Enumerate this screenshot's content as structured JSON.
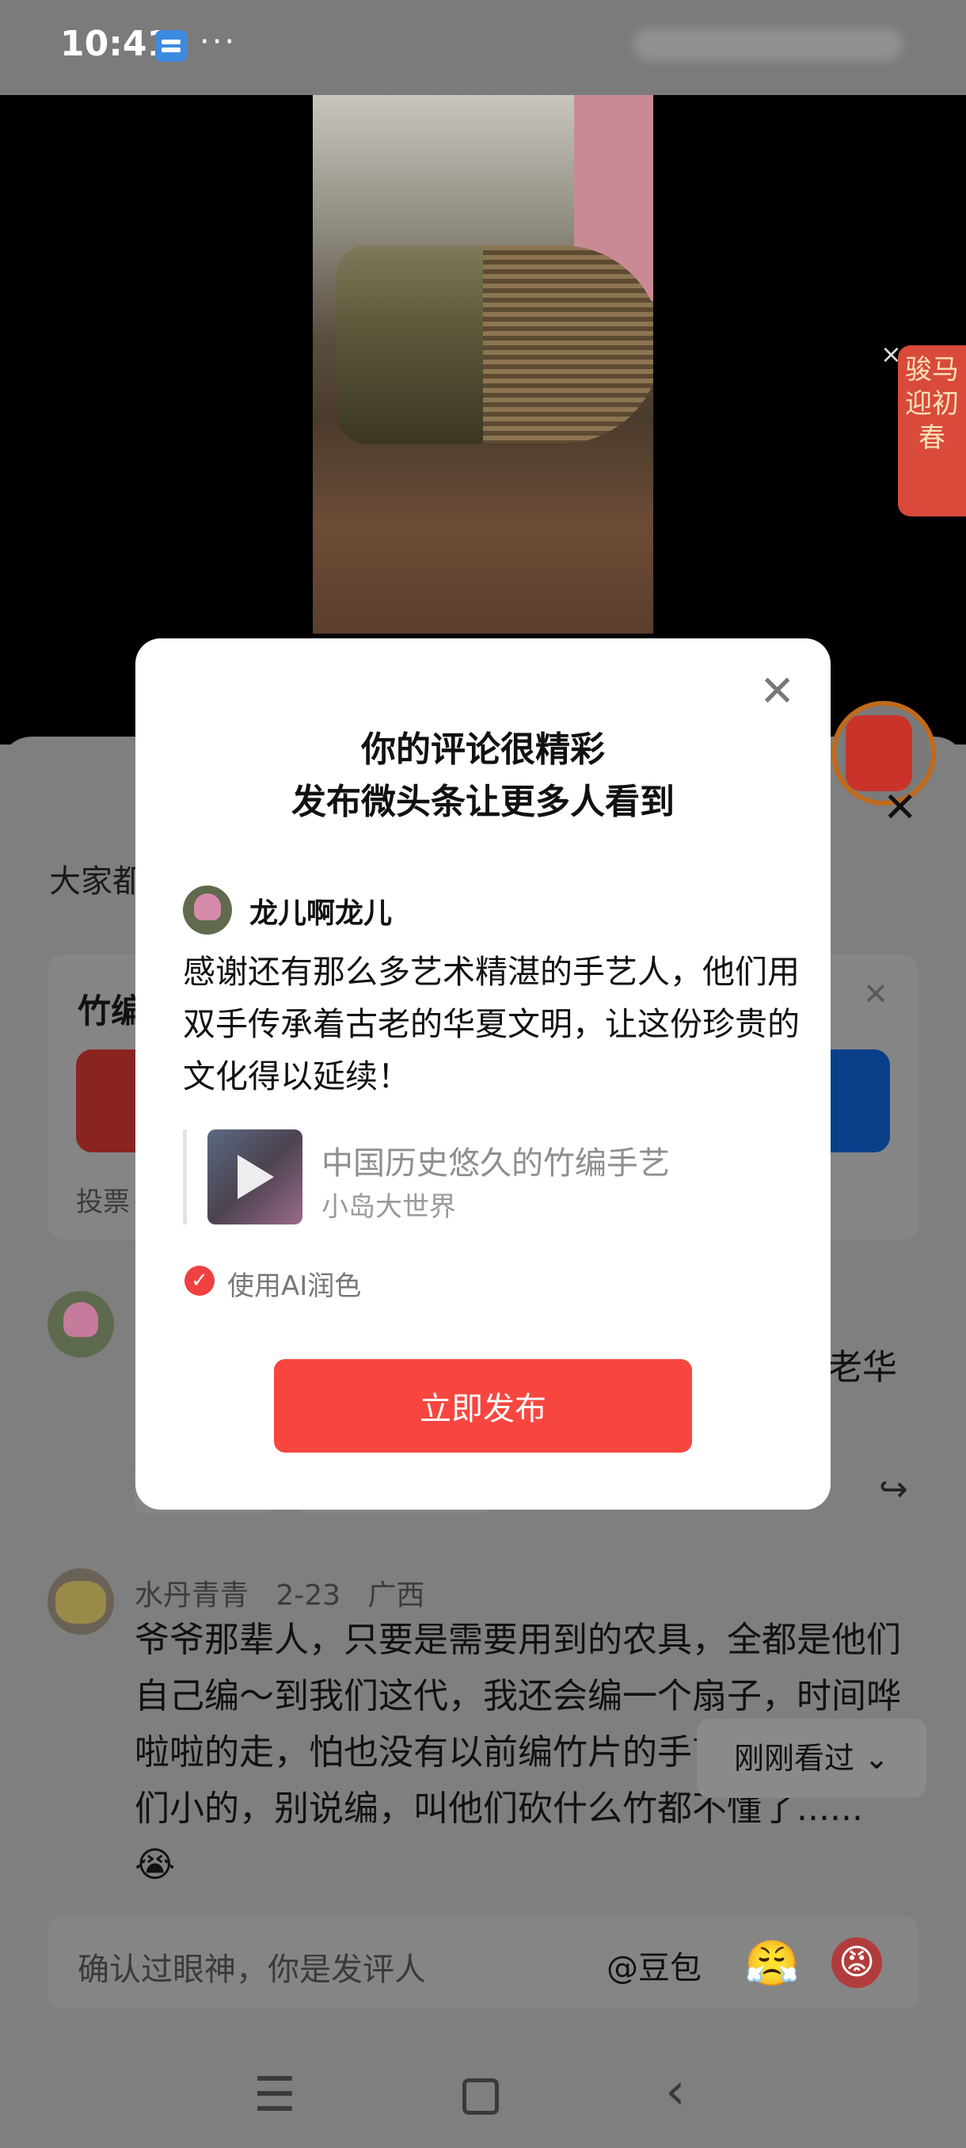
{
  "status_bar": {
    "time": "10:41",
    "more": "···"
  },
  "banner": {
    "text": "骏马迎初春",
    "close": "×"
  },
  "sheet": {
    "close": "✕",
    "peek_title": "大家都",
    "poll": {
      "title": "竹编",
      "close": "✕",
      "footer": "投票"
    },
    "peek_comment_tail": "老华",
    "share": "↪"
  },
  "comment2": {
    "author": "水丹青青",
    "date": "2-23",
    "location": "广西",
    "text": "爷爷那辈人，只要是需要用到的农具，全都是他们自己编～到我们这代，我还会编一个扇子，时间哗啦啦的走，怕也没有以前编竹片的手艺了...再比我们小的，别说编，叫他们砍什么竹都不懂了......😭"
  },
  "recently_viewed": "刚刚看过 ⌄",
  "input_bar": {
    "placeholder": "确认过眼神，你是发评人",
    "mention": "@豆包",
    "emoji1": "😤",
    "emoji2": "😡"
  },
  "nav": {
    "menu": "☰",
    "back": "‹"
  },
  "modal": {
    "close": "✕",
    "title_line1": "你的评论很精彩",
    "title_line2": "发布微头条让更多人看到",
    "username": "龙儿啊龙儿",
    "comment": "感谢还有那么多艺术精湛的手艺人，他们用双手传承着古老的华夏文明，让这份珍贵的文化得以延续！",
    "quote_title": "中国历史悠久的竹编手艺",
    "quote_source": "小岛大世界",
    "ai_checked": "✓",
    "ai_label": "使用AI润色",
    "publish_button": "立即发布"
  },
  "colors": {
    "accent": "#f7463f",
    "overlay": "#7f7f7f"
  }
}
